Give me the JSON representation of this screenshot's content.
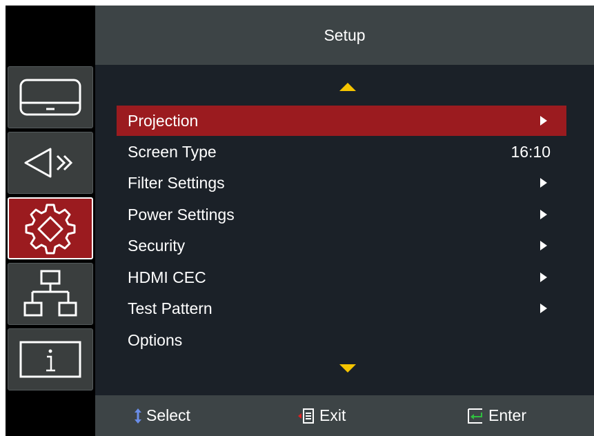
{
  "header": {
    "title": "Setup"
  },
  "sidebar": {
    "items": [
      {
        "name": "display",
        "icon": "monitor-icon",
        "active": false
      },
      {
        "name": "audio",
        "icon": "speaker-icon",
        "active": false
      },
      {
        "name": "setup",
        "icon": "gear-icon",
        "active": true
      },
      {
        "name": "network",
        "icon": "network-icon",
        "active": false
      },
      {
        "name": "information",
        "icon": "info-icon",
        "active": false
      }
    ]
  },
  "menu": {
    "items": [
      {
        "label": "Projection",
        "value": "",
        "submenu": true,
        "selected": true
      },
      {
        "label": "Screen Type",
        "value": "16:10",
        "submenu": false,
        "selected": false
      },
      {
        "label": "Filter Settings",
        "value": "",
        "submenu": true,
        "selected": false
      },
      {
        "label": "Power Settings",
        "value": "",
        "submenu": true,
        "selected": false
      },
      {
        "label": "Security",
        "value": "",
        "submenu": true,
        "selected": false
      },
      {
        "label": "HDMI CEC",
        "value": "",
        "submenu": true,
        "selected": false
      },
      {
        "label": "Test Pattern",
        "value": "",
        "submenu": true,
        "selected": false
      },
      {
        "label": "Options",
        "value": "",
        "submenu": false,
        "selected": false
      }
    ]
  },
  "footer": {
    "select_label": "Select",
    "exit_label": "Exit",
    "enter_label": "Enter"
  },
  "colors": {
    "accent_red": "#9b1b1f",
    "scroll_arrow": "#f5c400",
    "background": "#1b2128",
    "bar": "#3d4446"
  }
}
